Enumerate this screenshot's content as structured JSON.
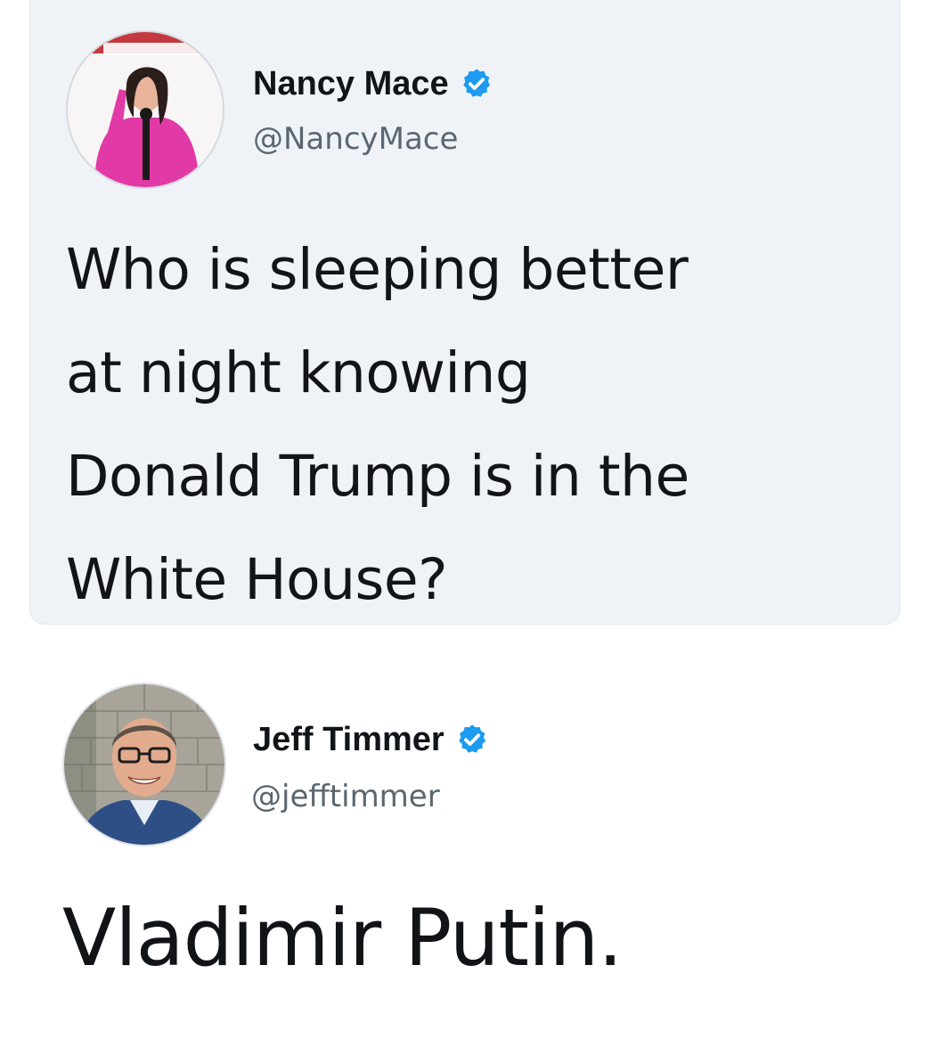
{
  "quoted_tweet": {
    "author_name": "Nancy Mace",
    "author_handle": "@NancyMace",
    "verified": true,
    "text": "Who is sleeping better\nat night knowing\nDonald Trump is in the\nWhite House?"
  },
  "reply": {
    "author_name": "Jeff Timmer",
    "author_handle": "@jefftimmer",
    "verified": true,
    "text": "Vladimir Putin."
  },
  "colors": {
    "verified_blue": "#1d9bf0",
    "card_background": "#eff3f7"
  }
}
